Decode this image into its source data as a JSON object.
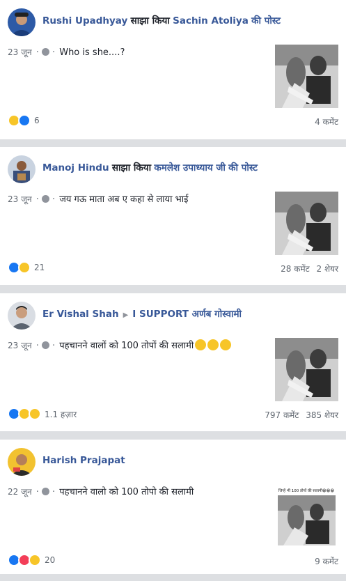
{
  "posts": [
    {
      "author": "Rushi Upadhyay",
      "action": "साझा किया",
      "target": "Sachin Atoliya",
      "suffix": "की पोस्ट",
      "date": "23 जून",
      "text": "Who is she....?",
      "reaction_count": "6",
      "comments": "4 कमेंट",
      "shares": ""
    },
    {
      "author": "Manoj Hindu",
      "action": "साझा किया",
      "target": "कमलेश उपाध्याय जी",
      "suffix": "की पोस्ट",
      "date": "23 जून",
      "text": "जय गऊ माता अब ए कहा से लाया भाई",
      "reaction_count": "21",
      "comments": "28 कमेंट",
      "shares": "2 शेयर"
    },
    {
      "author": "Er Vishal Shah",
      "target": "I SUPPORT अर्णब गोस्वामी",
      "date": "23 जून",
      "text": "पहचानने वालों को 100 तोपों की सलामी",
      "reaction_count": "1.1 हज़ार",
      "comments": "797 कमेंट",
      "shares": "385 शेयर"
    },
    {
      "author": "Harish Prajapat",
      "date": "22 जून",
      "text": "पहचानने वालो को 100 तोपो की सलामी",
      "reaction_count": "20",
      "comments": "9 कमेंट",
      "shares": ""
    }
  ],
  "colors": {
    "link": "#385898",
    "feed_bg": "#dddfe2",
    "like": "#1877f2",
    "love": "#f33e58",
    "haha": "#f7c528"
  },
  "thumbnail_caption": "जिन्हें भी 100 तोपों की सलामी😁😁😁"
}
